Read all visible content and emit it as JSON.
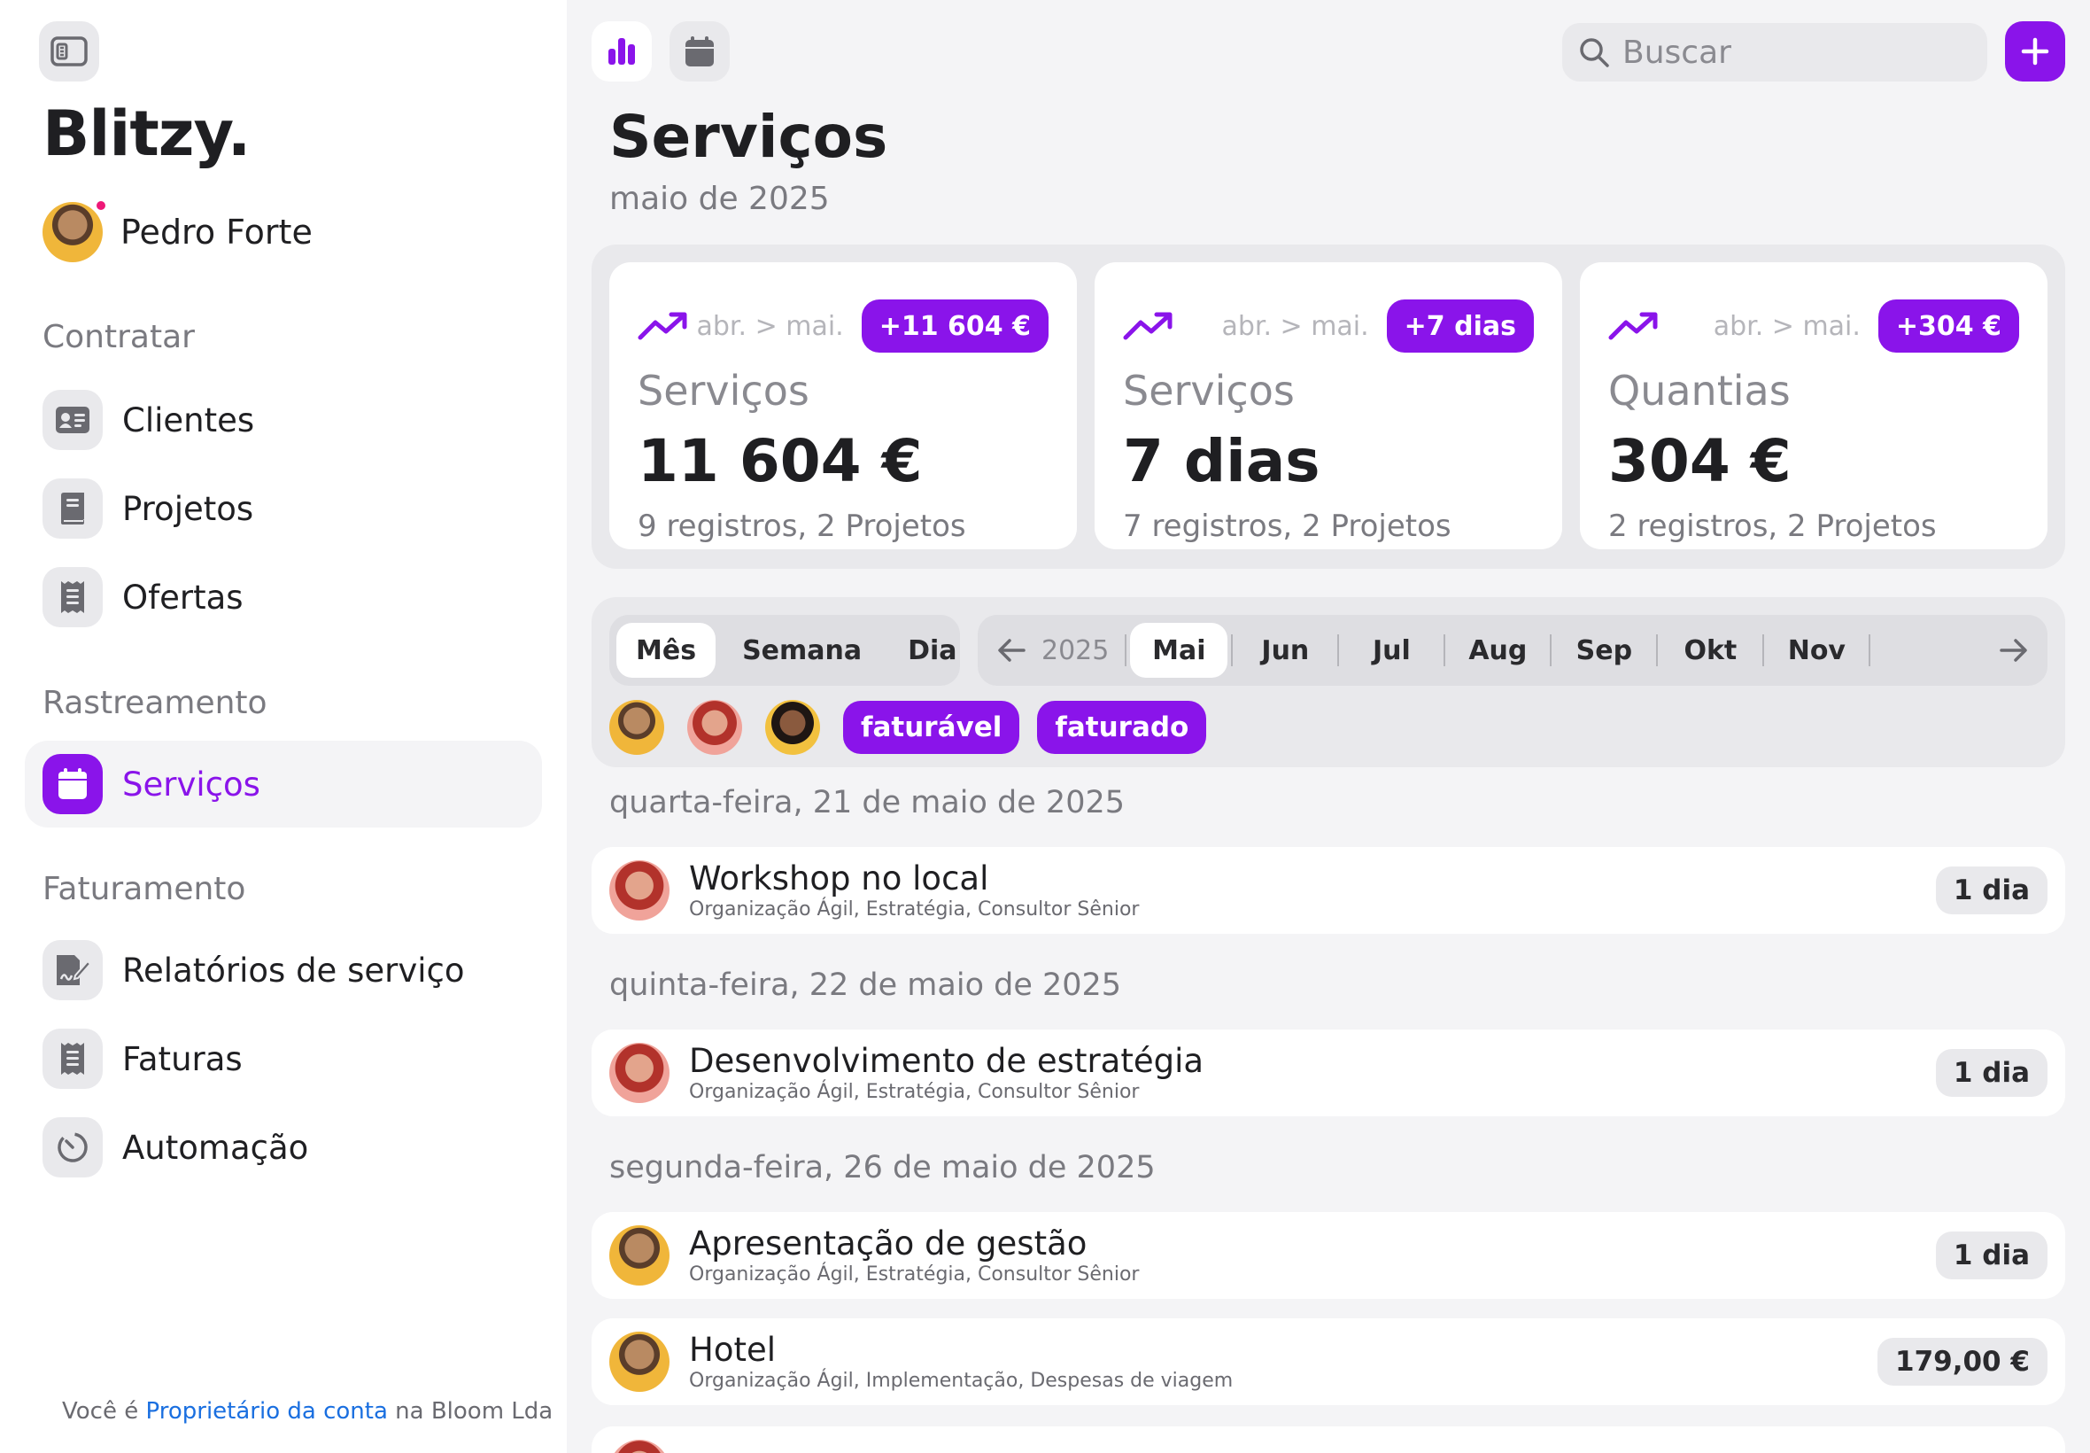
{
  "brand": "Blitzy.",
  "user": {
    "name": "Pedro Forte"
  },
  "sidebar": {
    "sections": [
      {
        "title": "Contratar",
        "items": [
          {
            "label": "Clientes",
            "icon": "contact-card-icon"
          },
          {
            "label": "Projetos",
            "icon": "book-icon"
          },
          {
            "label": "Ofertas",
            "icon": "receipt-icon"
          }
        ]
      },
      {
        "title": "Rastreamento",
        "items": [
          {
            "label": "Serviços",
            "icon": "calendar-icon",
            "active": true
          }
        ]
      },
      {
        "title": "Faturamento",
        "items": [
          {
            "label": "Relatórios de serviço",
            "icon": "signed-document-icon"
          },
          {
            "label": "Faturas",
            "icon": "receipt-icon"
          },
          {
            "label": "Automação",
            "icon": "timer-icon"
          }
        ]
      }
    ],
    "footer": {
      "prefix": "Você é",
      "link": "Proprietário da conta",
      "suffix": "na Bloom Lda"
    }
  },
  "topbar": {
    "search_placeholder": "Buscar"
  },
  "page": {
    "title": "Serviços",
    "subtitle": "maio de 2025"
  },
  "cards": [
    {
      "period": "abr. > mai.",
      "delta": "+11 604 €",
      "label": "Serviços",
      "value": "11 604 €",
      "meta": "9 registros, 2 Projetos"
    },
    {
      "period": "abr. > mai.",
      "delta": "+7 dias",
      "label": "Serviços",
      "value": "7 dias",
      "meta": "7 registros, 2 Projetos"
    },
    {
      "period": "abr. > mai.",
      "delta": "+304 €",
      "label": "Quantias",
      "value": "304 €",
      "meta": "2 registros, 2 Projetos"
    }
  ],
  "view_modes": [
    "Mês",
    "Semana",
    "Dia"
  ],
  "active_view": "Mês",
  "year": "2025",
  "months": [
    "Mai",
    "Jun",
    "Jul",
    "Aug",
    "Sep",
    "Okt",
    "Nov"
  ],
  "active_month": "Mai",
  "filter_chips": [
    "faturável",
    "faturado"
  ],
  "days": [
    {
      "date": "quarta-feira, 21 de maio de 2025",
      "entries": [
        {
          "title": "Workshop no local",
          "sub": "Organização Ágil, Estratégia, Consultor Sênior",
          "amount": "1 dia",
          "avatar": "f1"
        }
      ]
    },
    {
      "date": "quinta-feira, 22 de maio de 2025",
      "entries": [
        {
          "title": "Desenvolvimento de estratégia",
          "sub": "Organização Ágil, Estratégia, Consultor Sênior",
          "amount": "1 dia",
          "avatar": "f1"
        }
      ]
    },
    {
      "date": "segunda-feira, 26 de maio de 2025",
      "entries": [
        {
          "title": "Apresentação de gestão",
          "sub": "Organização Ágil, Estratégia, Consultor Sênior",
          "amount": "1 dia",
          "avatar": "m"
        },
        {
          "title": "Hotel",
          "sub": "Organização Ágil, Implementação, Despesas de viagem",
          "amount": "179,00 €",
          "avatar": "m"
        }
      ]
    }
  ],
  "colors": {
    "accent": "#8a14ea",
    "notification": "#ee1877",
    "link": "#1a6fe0"
  }
}
